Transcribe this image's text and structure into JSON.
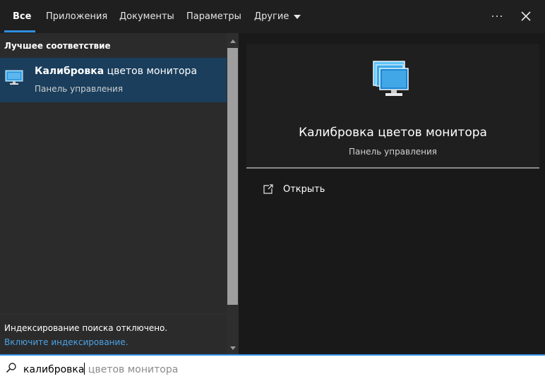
{
  "tabs": [
    {
      "label": "Все",
      "active": true
    },
    {
      "label": "Приложения"
    },
    {
      "label": "Документы"
    },
    {
      "label": "Параметры"
    },
    {
      "label": "Другие",
      "dropdown": true
    }
  ],
  "toolbar": {
    "more_icon": "ellipsis-icon",
    "close_icon": "close-icon"
  },
  "left": {
    "section_label": "Лучшее соответствие",
    "best_match": {
      "title_bold": "Калибровка",
      "title_rest": " цветов монитора",
      "subtitle": "Панель управления",
      "icon": "monitor-icon"
    },
    "footer": {
      "text": "Индексирование поиска отключено.",
      "link": "Включите индексирование."
    }
  },
  "detail": {
    "title": "Калибровка цветов монитора",
    "subtitle": "Панель управления",
    "icon": "monitor-icon",
    "actions": [
      {
        "label": "Открыть",
        "icon": "open-external-icon"
      }
    ]
  },
  "search": {
    "typed": "калибровка",
    "suggestion": " цветов монитора",
    "icon": "search-icon"
  },
  "colors": {
    "accent": "#2f8ee0",
    "selected_row": "#1a3e5c",
    "link": "#4aa3e8"
  }
}
